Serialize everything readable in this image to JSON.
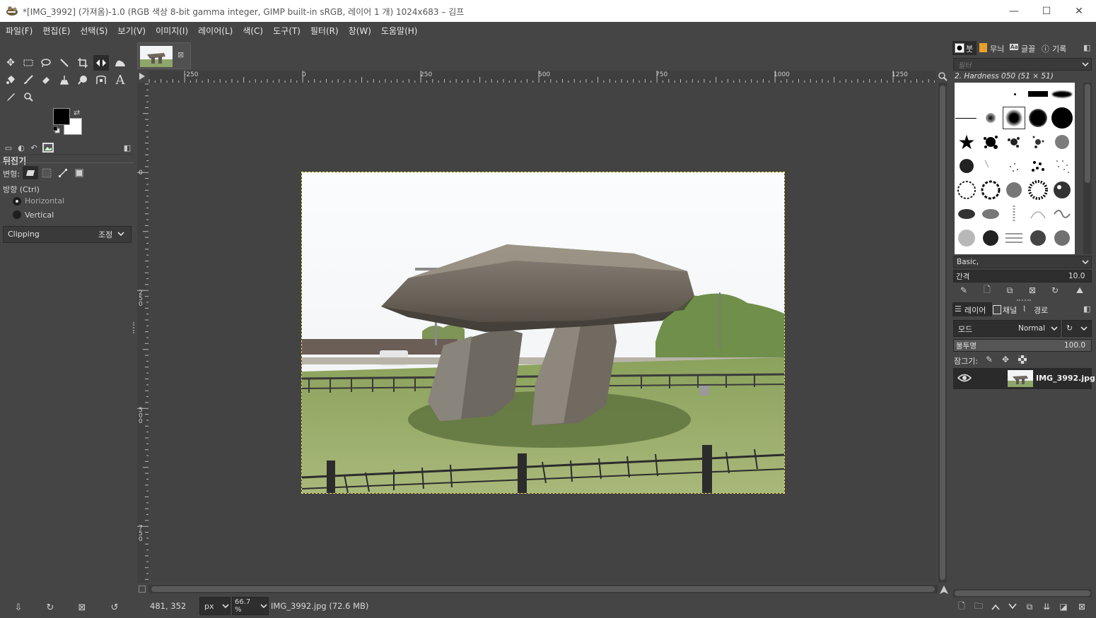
{
  "window": {
    "title": "*[IMG_3992] (가져옴)-1.0 (RGB 색상 8-bit gamma integer, GIMP built-in sRGB, 레이어 1 개) 1024x683 – 김프",
    "minimize": "—",
    "maximize": "☐",
    "close": "✕"
  },
  "menu": [
    "파일(F)",
    "편집(E)",
    "선택(S)",
    "보기(V)",
    "이미지(I)",
    "레이어(L)",
    "색(C)",
    "도구(T)",
    "필터(R)",
    "창(W)",
    "도움말(H)"
  ],
  "tool_options": {
    "title": "뒤집기",
    "transform_label": "변형:",
    "direction_label": "방향 (Ctrl)",
    "horizontal": "Horizontal",
    "vertical": "Vertical",
    "direction_selected": "Horizontal",
    "clipping_label": "Clipping",
    "clipping_value": "조정"
  },
  "rulers": {
    "h_labels": [
      "-250",
      "0",
      "250",
      "500",
      "750",
      "1000",
      "1250"
    ],
    "v_labels": [
      "0",
      "250",
      "500",
      "750"
    ]
  },
  "status": {
    "coords": "481, 352",
    "unit": "px",
    "zoom": "66.7 %",
    "file_info": "IMG_3992.jpg (72.6 MB)"
  },
  "brushes_panel": {
    "tabs": [
      "붓",
      "무늬",
      "글꼴",
      "기록"
    ],
    "filter_placeholder": "필터",
    "brush_name": "2. Hardness 050 (51 × 51)",
    "preset": "Basic,",
    "spacing_label": "간격",
    "spacing_value": "10.0"
  },
  "layers_panel": {
    "tabs": [
      "레이어",
      "채널",
      "경로"
    ],
    "mode_label": "모드",
    "mode_value": "Normal",
    "opacity_label": "불투명",
    "opacity_value": "100.0",
    "lock_label": "잠그기:",
    "layer_name": "IMG_3992.jpg"
  },
  "colors": {
    "foreground": "#000000",
    "background": "#ffffff",
    "selection_outline": "#f0e060"
  }
}
